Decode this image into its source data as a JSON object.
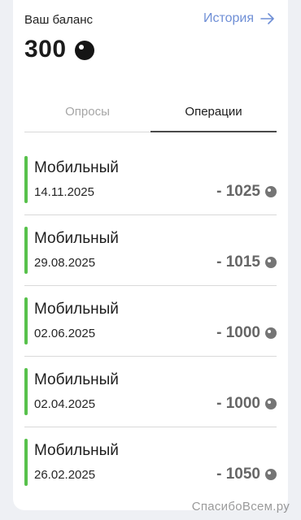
{
  "header": {
    "balance_label": "Ваш баланс",
    "history_label": "История",
    "balance_value": "300"
  },
  "tabs": [
    {
      "label": "Опросы",
      "active": false
    },
    {
      "label": "Операции",
      "active": true
    }
  ],
  "operations": [
    {
      "title": "Мобильный",
      "date": "14.11.2025",
      "amount": "- 1025"
    },
    {
      "title": "Мобильный",
      "date": "29.08.2025",
      "amount": "- 1015"
    },
    {
      "title": "Мобильный",
      "date": "02.06.2025",
      "amount": "- 1000"
    },
    {
      "title": "Мобильный",
      "date": "02.04.2025",
      "amount": "- 1000"
    },
    {
      "title": "Мобильный",
      "date": "26.02.2025",
      "amount": "- 1050"
    }
  ],
  "watermark": "СпасибоВсем.ру",
  "colors": {
    "accent": "#6f8fd6",
    "operation_bar": "#57c14b",
    "amount_text": "#666666"
  },
  "icons": {
    "currency": "ball-icon",
    "history_arrow": "arrow-right-icon"
  }
}
